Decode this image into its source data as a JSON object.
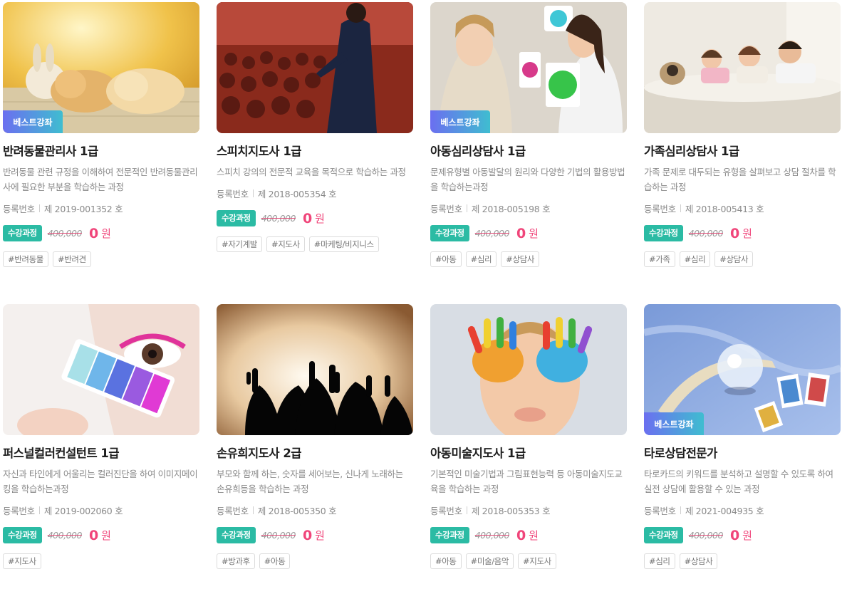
{
  "labels": {
    "best": "베스트강좌",
    "course": "수강과정",
    "reg_label": "등록번호",
    "currency": "원"
  },
  "colors": {
    "best_gradient_start": "#6b6ff0",
    "best_gradient_end": "#3fbdd0",
    "course_badge": "#2bbba4",
    "price": "#f0457a"
  },
  "cards": [
    {
      "image_icon": "puppies-rabbit-photo",
      "best": true,
      "title": "반려동물관리사 1급",
      "desc": "반려동물 관련 규정을 이해하여 전문적인 반려동물관리사에 필요한 부분을 학습하는 과정",
      "reg_no": "제 2019-001352 호",
      "old_price": "400,000",
      "new_price": "0",
      "tags": [
        "#반려동물",
        "#반려견"
      ]
    },
    {
      "image_icon": "speaker-audience-photo",
      "best": false,
      "title": "스피치지도사 1급",
      "desc": "스피치 강의의 전문적 교육을 목적으로 학습하는 과정",
      "reg_no": "제 2018-005354 호",
      "old_price": "400,000",
      "new_price": "0",
      "tags": [
        "#자기계발",
        "#지도사",
        "#마케팅/비지니스"
      ]
    },
    {
      "image_icon": "child-counseling-photo",
      "best": true,
      "title": "아동심리상담사 1급",
      "desc": "문제유형별 아동발달의 원리와 다양한 기법의 활용방법을 학습하는과정",
      "reg_no": "제 2018-005198 호",
      "old_price": "400,000",
      "new_price": "0",
      "tags": [
        "#아동",
        "#심리",
        "#상담사"
      ]
    },
    {
      "image_icon": "family-bed-photo",
      "best": false,
      "title": "가족심리상담사 1급",
      "desc": "가족 문제로 대두되는 유형을 살펴보고 상담 절차를 학습하는 과정",
      "reg_no": "제 2018-005413 호",
      "old_price": "400,000",
      "new_price": "0",
      "tags": [
        "#가족",
        "#심리",
        "#상담사"
      ]
    },
    {
      "image_icon": "color-palette-eye-photo",
      "best": false,
      "title": "퍼스널컬러컨설턴트 1급",
      "desc": "자신과 타인에게 어울리는 컬러진단을 하여 이미지메이킹을 학습하는과정",
      "reg_no": "제 2019-002060 호",
      "old_price": "400,000",
      "new_price": "0",
      "tags": [
        "#지도사"
      ]
    },
    {
      "image_icon": "hands-silhouette-photo",
      "best": false,
      "title": "손유희지도사 2급",
      "desc": "부모와 함께 하는, 숫자를 세어보는, 신나게 노래하는 손유희등을 학습하는 과정",
      "reg_no": "제 2018-005350 호",
      "old_price": "400,000",
      "new_price": "0",
      "tags": [
        "#방과후",
        "#아동"
      ]
    },
    {
      "image_icon": "painted-hands-child-photo",
      "best": false,
      "title": "아동미술지도사 1급",
      "desc": "기본적인 미술기법과 그림표현능력 등 아동미술지도교육을 학습하는 과정",
      "reg_no": "제 2018-005353 호",
      "old_price": "400,000",
      "new_price": "0",
      "tags": [
        "#아동",
        "#미술/음악",
        "#지도사"
      ]
    },
    {
      "image_icon": "tarot-crystal-ball-photo",
      "best": true,
      "title": "타로상담전문가",
      "desc": "타로카드의 키워드를 분석하고 설명할 수 있도록 하여 실전 상담에 활용할 수 있는 과정",
      "reg_no": "제 2021-004935 호",
      "old_price": "400,000",
      "new_price": "0",
      "tags": [
        "#심리",
        "#상담사"
      ]
    }
  ]
}
